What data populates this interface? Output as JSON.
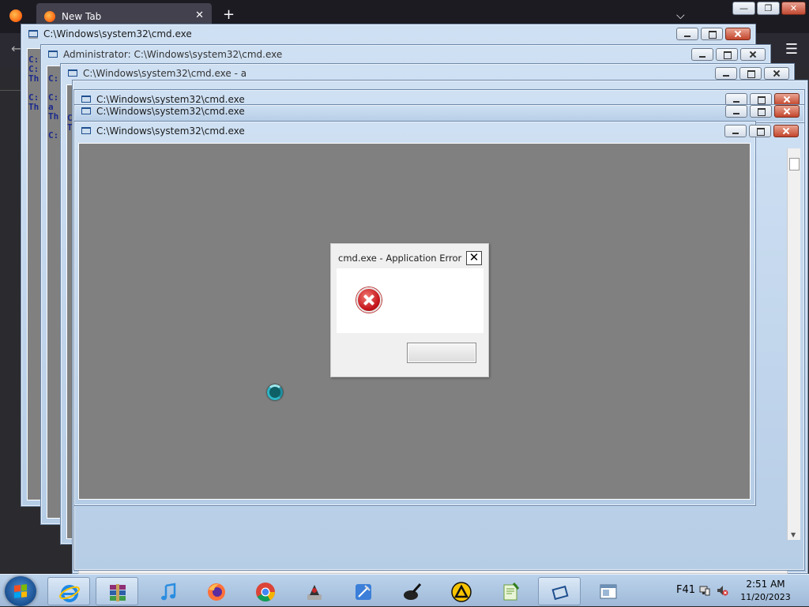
{
  "browser": {
    "tab_title": "New Tab",
    "tab_close": "✕",
    "new_tab": "+",
    "all_tabs": "⌵",
    "back": "←",
    "menu": "☰",
    "win_min": "—",
    "win_restore": "❐",
    "win_close": "✕"
  },
  "windows": [
    {
      "title": "C:\\Windows\\system32\\cmd.exe"
    },
    {
      "title": "Administrator: C:\\Windows\\system32\\cmd.exe"
    },
    {
      "title": "C:\\Windows\\system32\\cmd.exe - a"
    },
    {
      "title": "C:\\Windows\\system32\\cmd.exe"
    },
    {
      "title": "C:\\Windows\\system32\\cmd.exe"
    },
    {
      "title": "C:\\Windows\\system32\\cmd.exe"
    }
  ],
  "console_fragments": {
    "w1": [
      "C:",
      "",
      "C:",
      "Th",
      "",
      "C:",
      "Th"
    ],
    "w2": [
      "C:",
      "",
      "C:",
      "a",
      "Th",
      "",
      "C:"
    ],
    "w3": [
      "C",
      "T"
    ]
  },
  "dialog": {
    "title": "cmd.exe - Application Error",
    "close": "✕",
    "message": "",
    "ok_label": ""
  },
  "taskbar": {
    "items": [
      {
        "name": "internet-explorer",
        "active": true
      },
      {
        "name": "winrar",
        "active": true
      },
      {
        "name": "itunes",
        "active": false
      },
      {
        "name": "firefox",
        "active": false
      },
      {
        "name": "chrome",
        "active": false
      },
      {
        "name": "java-installer",
        "active": false
      },
      {
        "name": "xcode",
        "active": false
      },
      {
        "name": "ink-tool",
        "active": false
      },
      {
        "name": "aimp",
        "active": false
      },
      {
        "name": "notepad-plus-plus",
        "active": false
      },
      {
        "name": "cmd-windows",
        "active": true
      },
      {
        "name": "explorer-window",
        "active": false
      }
    ],
    "tray_text": "F41",
    "time": "2:51 AM",
    "date": "11/20/2023"
  },
  "colors": {
    "console_bg": "#808080",
    "dialog_bg": "#f0f0f0",
    "taskbar": "#a9c1dc"
  }
}
